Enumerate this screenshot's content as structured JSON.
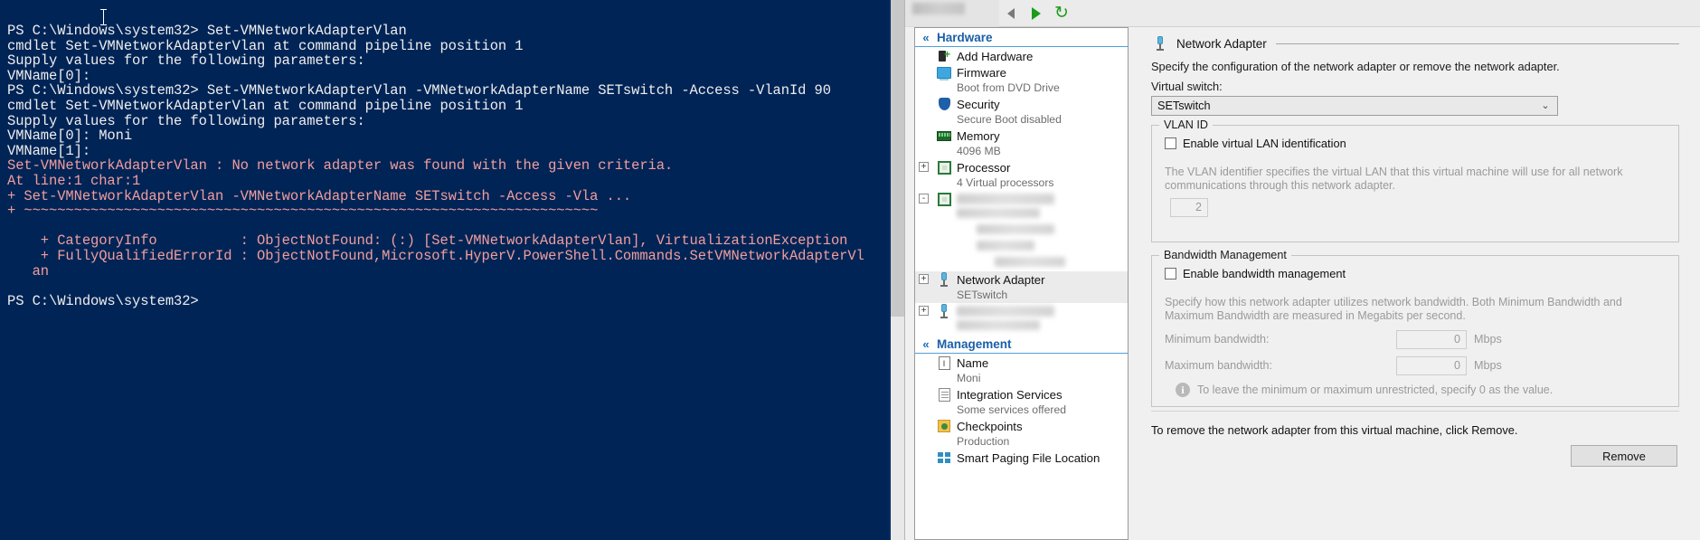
{
  "console": {
    "name": "powershell-console",
    "background": "#012456",
    "foreground": "#eeeeee",
    "error_color": "#f09e9e",
    "lines": [
      {
        "text": "PS C:\\Windows\\system32> Set-VMNetworkAdapterVlan",
        "type": "normal"
      },
      {
        "text": "cmdlet Set-VMNetworkAdapterVlan at command pipeline position 1",
        "type": "normal"
      },
      {
        "text": "Supply values for the following parameters:",
        "type": "normal"
      },
      {
        "text": "VMName[0]:",
        "type": "normal"
      },
      {
        "text": "PS C:\\Windows\\system32> Set-VMNetworkAdapterVlan -VMNetworkAdapterName SETswitch -Access -VlanId 90",
        "type": "normal"
      },
      {
        "text": "cmdlet Set-VMNetworkAdapterVlan at command pipeline position 1",
        "type": "normal"
      },
      {
        "text": "Supply values for the following parameters:",
        "type": "normal"
      },
      {
        "text": "VMName[0]: Moni",
        "type": "normal"
      },
      {
        "text": "VMName[1]:",
        "type": "normal"
      },
      {
        "text": "Set-VMNetworkAdapterVlan : No network adapter was found with the given criteria.",
        "type": "error"
      },
      {
        "text": "At line:1 char:1",
        "type": "error"
      },
      {
        "text": "+ Set-VMNetworkAdapterVlan -VMNetworkAdapterName SETswitch -Access -Vla ...",
        "type": "error"
      },
      {
        "text": "+ ~~~~~~~~~~~~~~~~~~~~~~~~~~~~~~~~~~~~~~~~~~~~~~~~~~~~~~~~~~~~~~~~~~~~~",
        "type": "error"
      },
      {
        "text": "",
        "type": "normal"
      },
      {
        "text": "    + CategoryInfo          : ObjectNotFound: (:) [Set-VMNetworkAdapterVlan], VirtualizationException",
        "type": "error"
      },
      {
        "text": "    + FullyQualifiedErrorId : ObjectNotFound,Microsoft.HyperV.PowerShell.Commands.SetVMNetworkAdapterVl",
        "type": "error"
      },
      {
        "text": "   an",
        "type": "error"
      },
      {
        "text": "",
        "type": "normal"
      },
      {
        "text": "PS C:\\Windows\\system32>",
        "type": "normal"
      }
    ]
  },
  "settings_window": {
    "toolbar": {
      "back_icon": "triangle-left-icon",
      "play_icon": "triangle-right-icon",
      "refresh_icon": "refresh-icon",
      "refresh_glyph": "↻"
    },
    "tree": {
      "sections": [
        {
          "label": "Hardware",
          "chevron": "«",
          "items": [
            {
              "label": "Add Hardware",
              "sub": "",
              "icon": "add-hardware-icon",
              "expander": "",
              "selected": false,
              "blurred": false
            },
            {
              "label": "Firmware",
              "sub": "Boot from DVD Drive",
              "icon": "firmware-icon",
              "expander": "",
              "selected": false,
              "blurred": false
            },
            {
              "label": "Security",
              "sub": "Secure Boot disabled",
              "icon": "shield-icon",
              "expander": "",
              "selected": false,
              "blurred": false
            },
            {
              "label": "Memory",
              "sub": "4096 MB",
              "icon": "memory-icon",
              "expander": "",
              "selected": false,
              "blurred": false
            },
            {
              "label": "Processor",
              "sub": "4 Virtual processors",
              "icon": "processor-icon",
              "expander": "+",
              "selected": false,
              "blurred": false
            },
            {
              "label": "",
              "sub": "",
              "icon": "scsi-controller-icon",
              "expander": "-",
              "selected": false,
              "blurred": true
            },
            {
              "label": "Network Adapter",
              "sub": "SETswitch",
              "icon": "network-adapter-icon",
              "expander": "+",
              "selected": true,
              "blurred": false
            },
            {
              "label": "Network Adapter",
              "sub": "",
              "icon": "network-adapter-icon",
              "expander": "+",
              "selected": false,
              "blurred": true
            }
          ]
        },
        {
          "label": "Management",
          "chevron": "«",
          "items": [
            {
              "label": "Name",
              "sub": "Moni",
              "icon": "name-icon",
              "expander": "",
              "selected": false,
              "blurred": false
            },
            {
              "label": "Integration Services",
              "sub": "Some services offered",
              "icon": "integration-services-icon",
              "expander": "",
              "selected": false,
              "blurred": false
            },
            {
              "label": "Checkpoints",
              "sub": "Production",
              "icon": "checkpoints-icon",
              "expander": "",
              "selected": false,
              "blurred": false
            },
            {
              "label": "Smart Paging File Location",
              "sub": "",
              "icon": "smart-paging-icon",
              "expander": "",
              "selected": false,
              "blurred": false
            }
          ]
        }
      ]
    },
    "detail": {
      "title": "Network Adapter",
      "title_icon": "network-adapter-icon",
      "description": "Specify the configuration of the network adapter or remove the network adapter.",
      "virtual_switch_label": "Virtual switch:",
      "virtual_switch_value": "SETswitch",
      "virtual_switch_chevron": "⌄",
      "vlan": {
        "legend": "VLAN ID",
        "enable_label": "Enable virtual LAN identification",
        "enable_checked": false,
        "hint": "The VLAN identifier specifies the virtual LAN that this virtual machine will use for all network communications through this network adapter.",
        "vlan_id_value": "2"
      },
      "bandwidth": {
        "legend": "Bandwidth Management",
        "enable_label": "Enable bandwidth management",
        "enable_checked": false,
        "hint": "Specify how this network adapter utilizes network bandwidth. Both Minimum Bandwidth and Maximum Bandwidth are measured in Megabits per second.",
        "min_label": "Minimum bandwidth:",
        "min_value": "0",
        "min_unit": "Mbps",
        "max_label": "Maximum bandwidth:",
        "max_value": "0",
        "max_unit": "Mbps",
        "info_icon": "info-icon",
        "info_glyph": "i",
        "info_text": "To leave the minimum or maximum unrestricted, specify 0 as the value."
      },
      "remove_note": "To remove the network adapter from this virtual machine, click Remove.",
      "remove_button": "Remove"
    }
  }
}
